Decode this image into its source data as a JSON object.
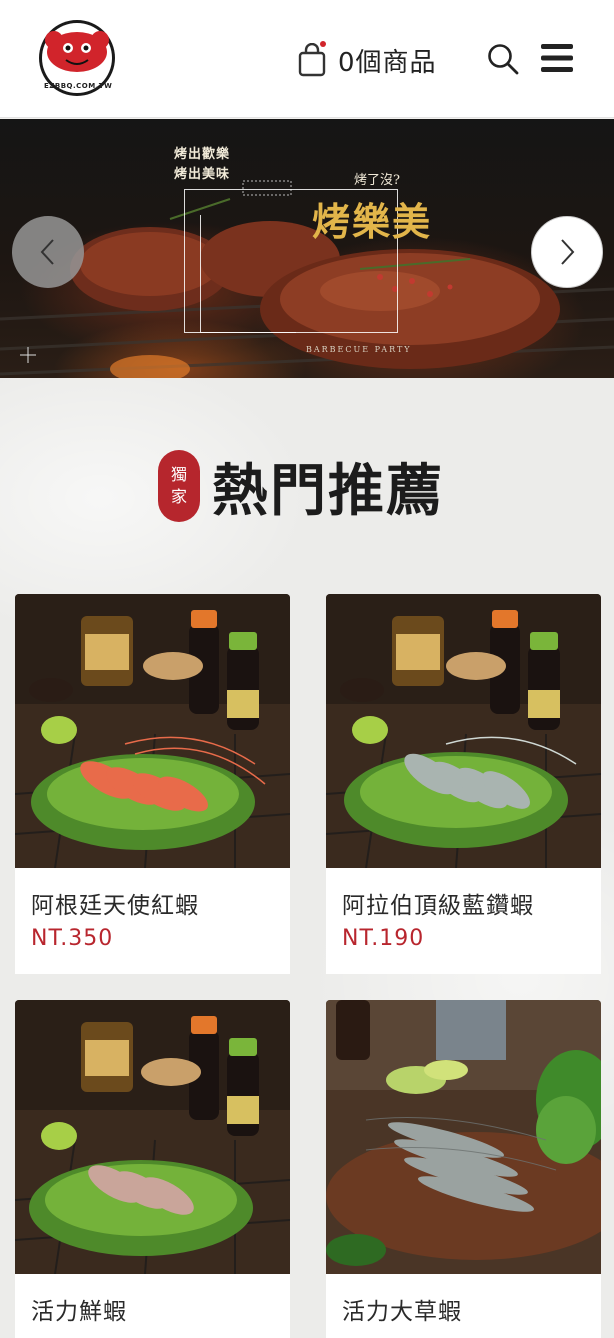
{
  "header": {
    "logo_text": "EZBBQ.COM.TW",
    "cart_label": "0個商品"
  },
  "banner": {
    "line1": "烤出歡樂",
    "line2": "烤出美味",
    "question": "烤了沒?",
    "title": "烤樂美",
    "subtitle": "BARBECUE PARTY"
  },
  "section": {
    "badge_line1": "獨",
    "badge_line2": "家",
    "title": "熱門推薦"
  },
  "products": [
    {
      "name": "阿根廷天使紅蝦",
      "price": "NT.350"
    },
    {
      "name": "阿拉伯頂級藍鑽蝦",
      "price": "NT.190"
    },
    {
      "name": "活力鮮蝦",
      "price": ""
    },
    {
      "name": "活力大草蝦",
      "price": ""
    }
  ],
  "colors": {
    "brand_red": "#b6262d",
    "price_red": "#b8262e",
    "banner_gold": "#e2b54a"
  }
}
